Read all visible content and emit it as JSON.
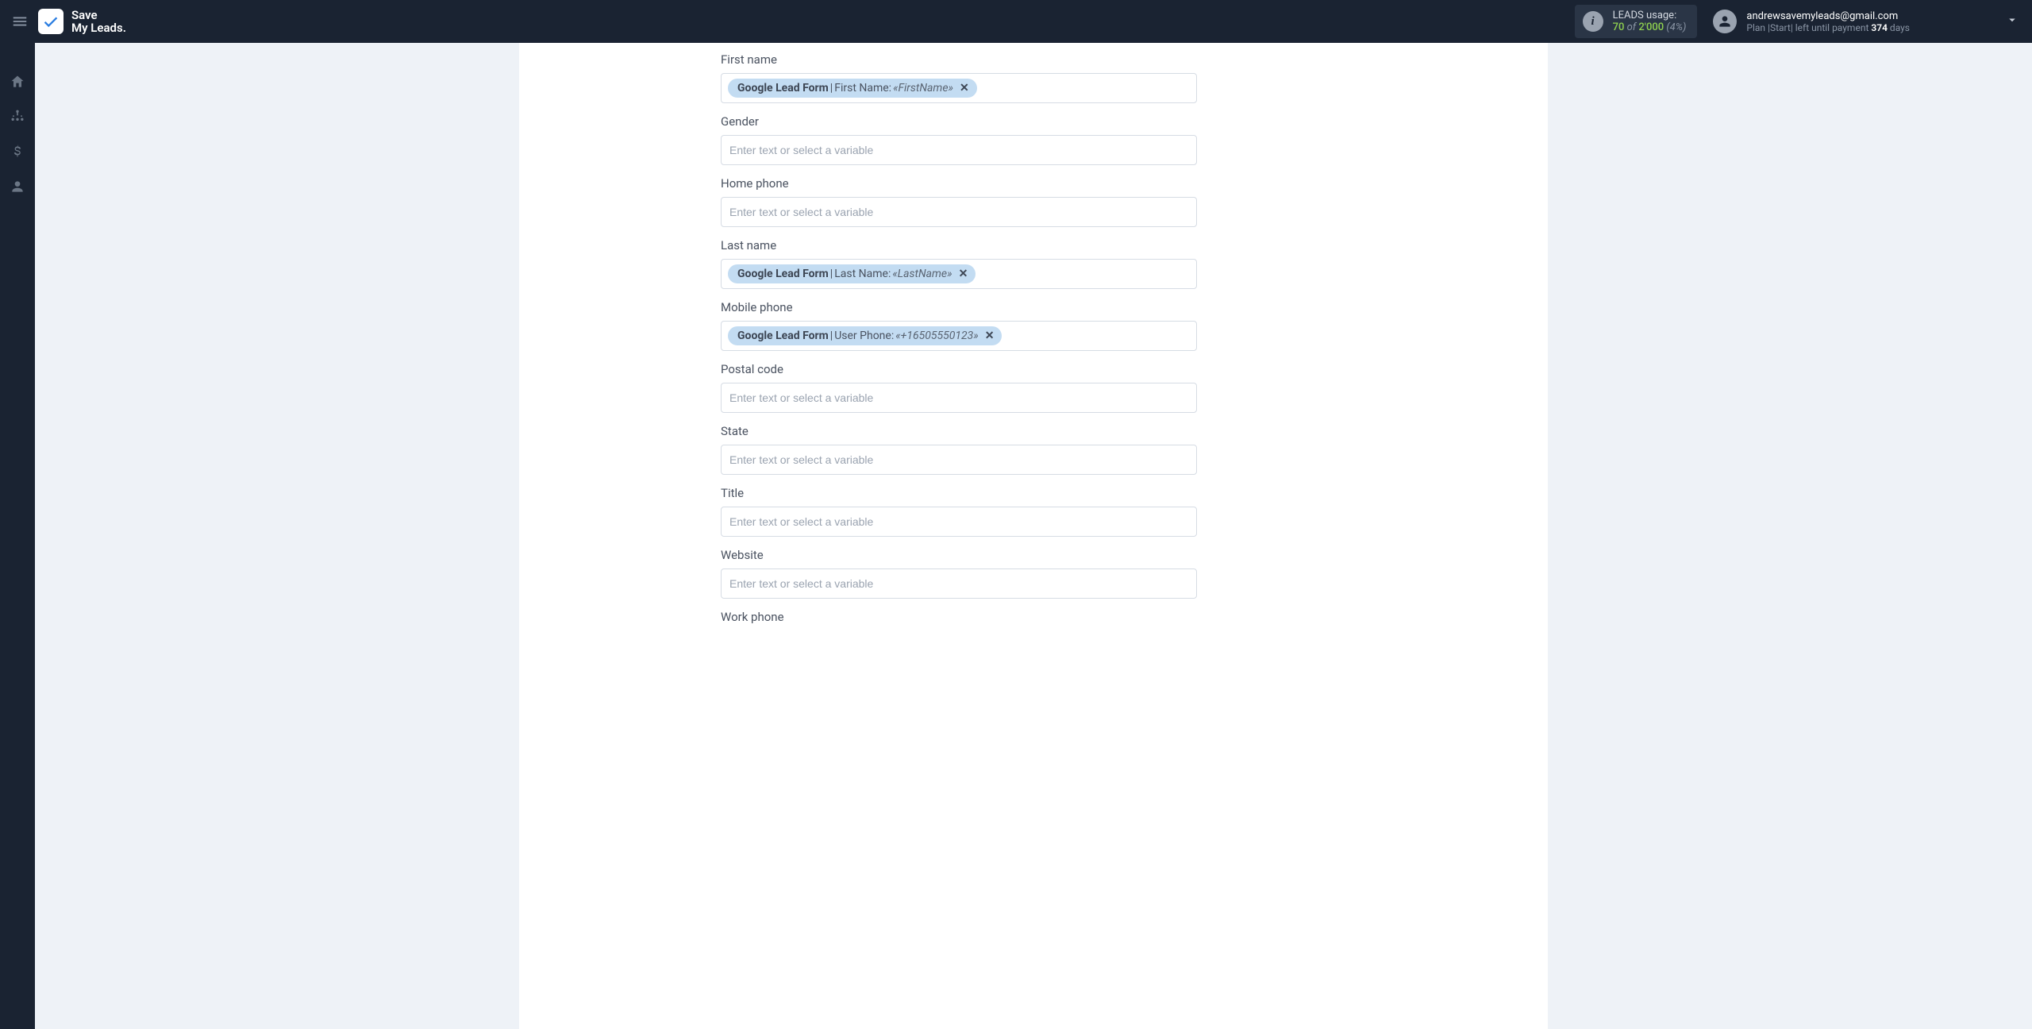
{
  "header": {
    "logo_text_line1": "Save",
    "logo_text_line2": "My Leads.",
    "leads_label": "LEADS usage:",
    "leads_used": "70",
    "leads_of": "of",
    "leads_total": "2'000",
    "leads_pct": "(4%)",
    "user_email": "andrewsavemyleads@gmail.com",
    "plan_prefix": "Plan |",
    "plan_name": "Start",
    "plan_mid": "| left until payment",
    "plan_days_num": "374",
    "plan_days_word": "days"
  },
  "placeholder": "Enter text or select a variable",
  "chip_source": "Google Lead Form",
  "fields": [
    {
      "id": "first_name",
      "label": "First name",
      "chip": {
        "field": "First Name:",
        "value": "«FirstName»"
      }
    },
    {
      "id": "gender",
      "label": "Gender",
      "chip": null
    },
    {
      "id": "home_phone",
      "label": "Home phone",
      "chip": null
    },
    {
      "id": "last_name",
      "label": "Last name",
      "chip": {
        "field": "Last Name:",
        "value": "«LastName»"
      }
    },
    {
      "id": "mobile_phone",
      "label": "Mobile phone",
      "chip": {
        "field": "User Phone:",
        "value": "«+16505550123»"
      }
    },
    {
      "id": "postal_code",
      "label": "Postal code",
      "chip": null
    },
    {
      "id": "state",
      "label": "State",
      "chip": null
    },
    {
      "id": "title",
      "label": "Title",
      "chip": null
    },
    {
      "id": "website",
      "label": "Website",
      "chip": null
    },
    {
      "id": "work_phone",
      "label": "Work phone",
      "chip": null
    }
  ]
}
